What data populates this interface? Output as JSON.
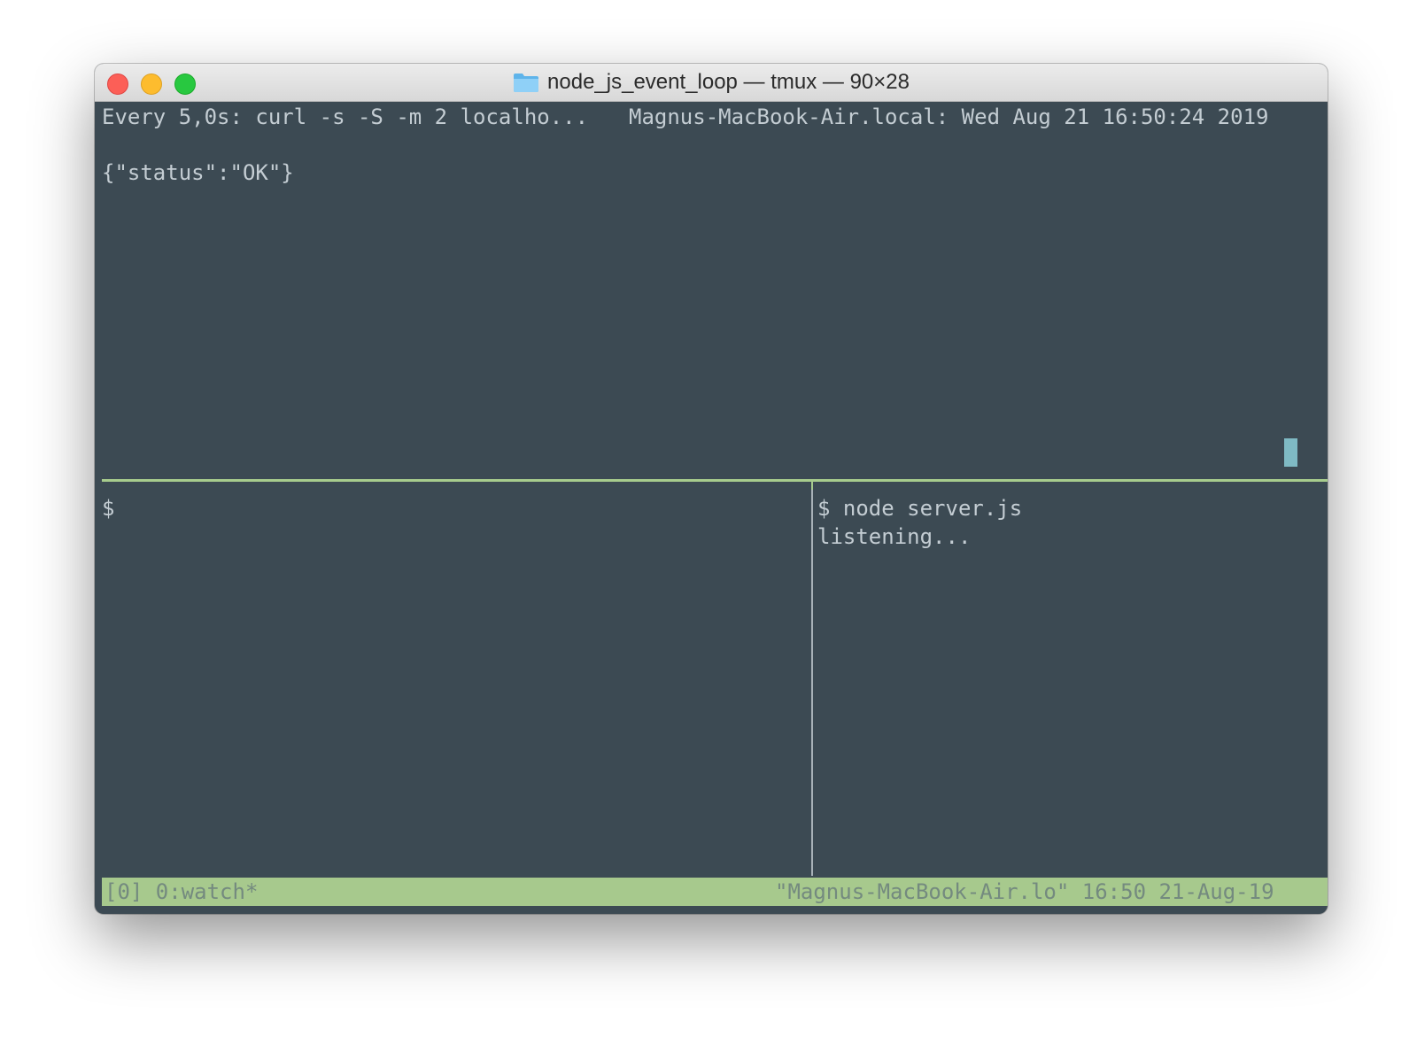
{
  "window": {
    "title": "node_js_event_loop — tmux — 90×28"
  },
  "colors": {
    "terminal_bg": "#3c4a53",
    "terminal_fg": "#c4cdd3",
    "pane_border_active": "#a7cc8d",
    "status_bar_bg": "#a7c98d",
    "cursor": "#7fbac4"
  },
  "icons": {
    "title": "folder-icon",
    "window_controls": [
      "close-icon",
      "minimize-icon",
      "zoom-icon"
    ]
  },
  "top_pane": {
    "header_left": "Every 5,0s: curl -s -S -m 2 localho...",
    "header_right": "Magnus-MacBook-Air.local: Wed Aug 21 16:50:24 2019",
    "output": "{\"status\":\"OK\"}"
  },
  "bottom_left_pane": {
    "prompt": "$"
  },
  "bottom_right_pane": {
    "command": "$ node server.js",
    "output": "listening..."
  },
  "status_bar": {
    "left": "[0] 0:watch*",
    "right": "\"Magnus-MacBook-Air.lo\" 16:50 21-Aug-19"
  }
}
